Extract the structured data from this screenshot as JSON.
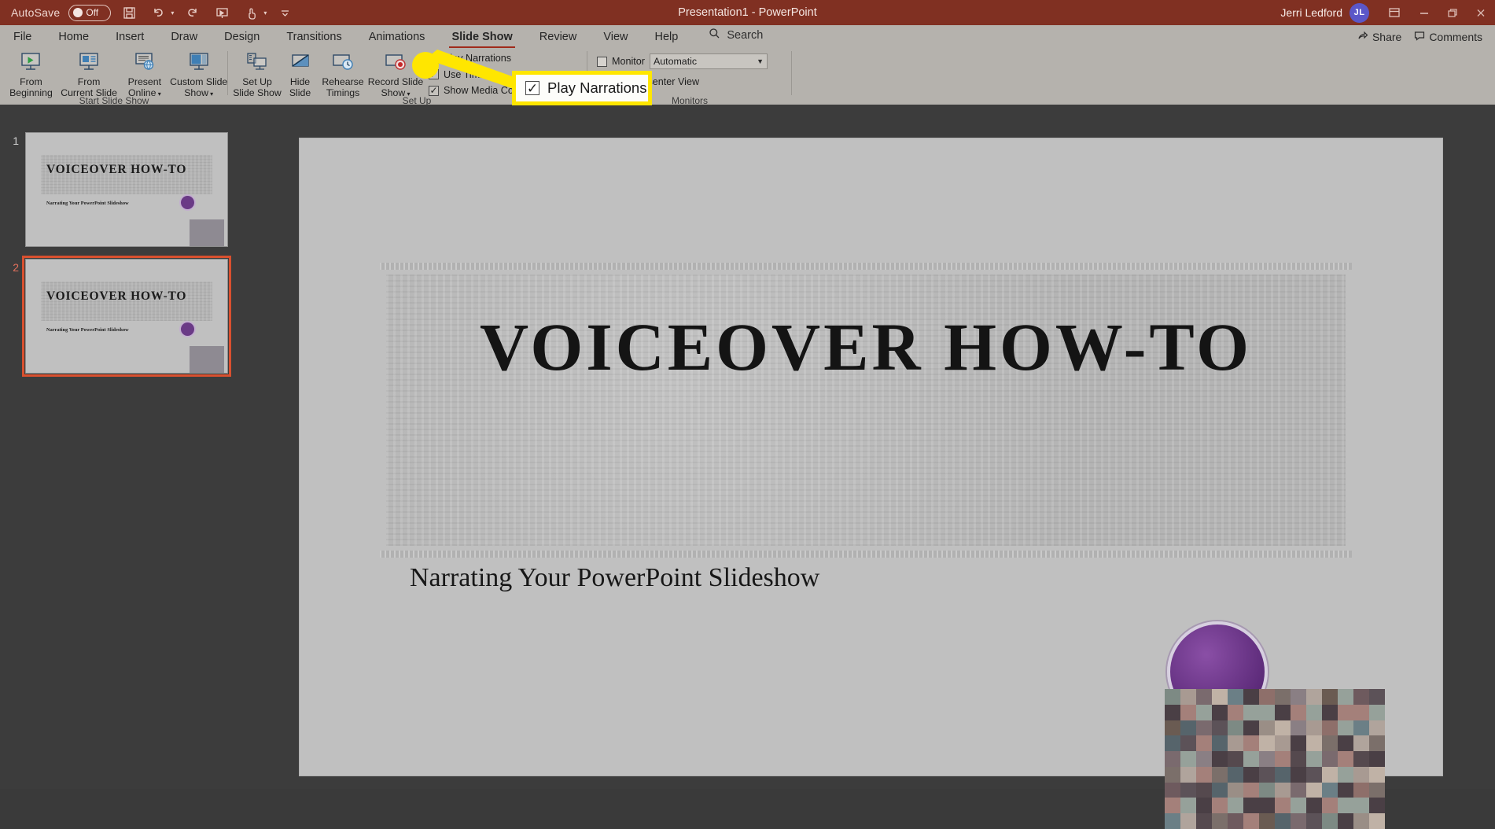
{
  "titlebar": {
    "autosave_label": "AutoSave",
    "autosave_state": "Off",
    "window_title": "Presentation1 - PowerPoint",
    "username": "Jerri Ledford",
    "avatar_initials": "JL",
    "quick_access": [
      {
        "name": "save-icon",
        "glyph": "save"
      },
      {
        "name": "undo-icon",
        "glyph": "undo"
      },
      {
        "name": "redo-icon",
        "glyph": "redo"
      },
      {
        "name": "start-from-beginning-icon",
        "glyph": "present"
      },
      {
        "name": "touch-mode-icon",
        "glyph": "touch"
      },
      {
        "name": "customize-quick-access-toolbar-icon",
        "glyph": "caret"
      }
    ],
    "window_buttons": [
      {
        "name": "ribbon-display-options-button",
        "glyph": "▭"
      },
      {
        "name": "minimize-button",
        "glyph": "—"
      },
      {
        "name": "restore-button",
        "glyph": "❐"
      },
      {
        "name": "close-button",
        "glyph": "✕"
      }
    ],
    "brand_color": "#803022"
  },
  "tabs": [
    {
      "label": "File",
      "active": false
    },
    {
      "label": "Home",
      "active": false
    },
    {
      "label": "Insert",
      "active": false
    },
    {
      "label": "Draw",
      "active": false
    },
    {
      "label": "Design",
      "active": false
    },
    {
      "label": "Transitions",
      "active": false
    },
    {
      "label": "Animations",
      "active": false
    },
    {
      "label": "Slide Show",
      "active": true
    },
    {
      "label": "Review",
      "active": false
    },
    {
      "label": "View",
      "active": false
    },
    {
      "label": "Help",
      "active": false
    }
  ],
  "search": {
    "placeholder": "Search"
  },
  "tabstrip_right": [
    {
      "label": "Share",
      "name": "share-button"
    },
    {
      "label": "Comments",
      "name": "comments-button"
    }
  ],
  "ribbon": {
    "groups": [
      {
        "name": "start-slide-show",
        "group_label": "Start Slide Show",
        "items": [
          {
            "label_line1": "From",
            "label_line2": "Beginning",
            "name": "from-beginning-button",
            "caret": false
          },
          {
            "label_line1": "From",
            "label_line2": "Current Slide",
            "name": "from-current-slide-button",
            "caret": false
          },
          {
            "label_line1": "Present",
            "label_line2": "Online",
            "name": "present-online-button",
            "caret": true
          },
          {
            "label_line1": "Custom Slide",
            "label_line2": "Show",
            "name": "custom-slide-show-button",
            "caret": true
          }
        ]
      },
      {
        "name": "set-up",
        "group_label": "Set Up",
        "items": [
          {
            "label_line1": "Set Up",
            "label_line2": "Slide Show",
            "name": "set-up-slide-show-button",
            "caret": false
          },
          {
            "label_line1": "Hide",
            "label_line2": "Slide",
            "name": "hide-slide-button",
            "caret": false
          },
          {
            "label_line1": "Rehearse",
            "label_line2": "Timings",
            "name": "rehearse-timings-button",
            "caret": false
          },
          {
            "label_line1": "Record Slide",
            "label_line2": "Show",
            "name": "record-slide-show-button",
            "caret": true
          }
        ],
        "checkboxes": [
          {
            "label": "Play Narrations",
            "checked": true,
            "name": "play-narrations-checkbox"
          },
          {
            "label": "Use Timings",
            "checked": true,
            "name": "use-timings-checkbox"
          },
          {
            "label": "Show Media Controls",
            "checked": true,
            "name": "show-media-controls-checkbox"
          }
        ]
      },
      {
        "name": "monitors",
        "group_label": "Monitors",
        "monitor_label": "Monitor",
        "monitor_value": "Automatic",
        "use_presenter_view_label": "Use Presenter View",
        "use_presenter_view_checked": false
      }
    ]
  },
  "callout": {
    "label": "Play Narrations",
    "checked": true,
    "highlight_color": "#ffe600"
  },
  "thumbnails": [
    {
      "number": "1",
      "selected": false,
      "title": "VOICEOVER HOW-TO",
      "subtitle": "Narrating Your PowerPoint Slideshow",
      "name": "slide-thumbnail-1"
    },
    {
      "number": "2",
      "selected": true,
      "title": "VOICEOVER HOW-TO",
      "subtitle": "Narrating Your PowerPoint Slideshow",
      "name": "slide-thumbnail-2"
    }
  ],
  "slide": {
    "title": "VOICEOVER HOW-TO",
    "subtitle": "Narrating Your PowerPoint Slideshow",
    "avatar_name": "presenter-video-bubble",
    "camera_name": "camera-preview"
  }
}
